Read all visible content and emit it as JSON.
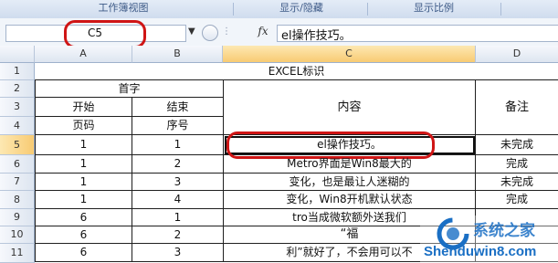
{
  "ribbon": {
    "groups": [
      "工作簿视图",
      "显示/隐藏",
      "显示比例"
    ]
  },
  "formula_bar": {
    "name_box": "C5",
    "fx_label": "fx",
    "formula": "el操作技巧。"
  },
  "columns": [
    "A",
    "B",
    "C",
    "D"
  ],
  "rows": [
    "1",
    "2",
    "3",
    "4",
    "5",
    "6",
    "7",
    "8",
    "9",
    "10",
    "11"
  ],
  "sheet": {
    "title": "EXCEL标识",
    "header": {
      "group": "首字",
      "start": "开始",
      "end": "结束",
      "page": "页码",
      "seq": "序号",
      "content": "内容",
      "note": "备注"
    },
    "data_rows": [
      {
        "a": "1",
        "b": "1",
        "c": "el操作技巧。",
        "d": "未完成"
      },
      {
        "a": "1",
        "b": "2",
        "c": "Metro界面是Win8最大的",
        "d": "完成"
      },
      {
        "a": "1",
        "b": "3",
        "c": "变化，也是最让人迷糊的",
        "d": "未完成"
      },
      {
        "a": "1",
        "b": "4",
        "c": "变化，Win8开机默认状态",
        "d": "完成"
      },
      {
        "a": "6",
        "b": "1",
        "c": "tro当成微软额外送我们",
        "d": ""
      },
      {
        "a": "6",
        "b": "2",
        "c": "“福",
        "d": ""
      },
      {
        "a": "6",
        "b": "3",
        "c": "利”就好了，不会用可以不",
        "d": ""
      }
    ]
  },
  "watermark": {
    "brand": "系统之家",
    "url": "Shenduwin8.com"
  },
  "colors": {
    "highlight_ring": "#cf1515",
    "selected_header": "#f8cb73",
    "ribbon": "#dbe5f2"
  }
}
